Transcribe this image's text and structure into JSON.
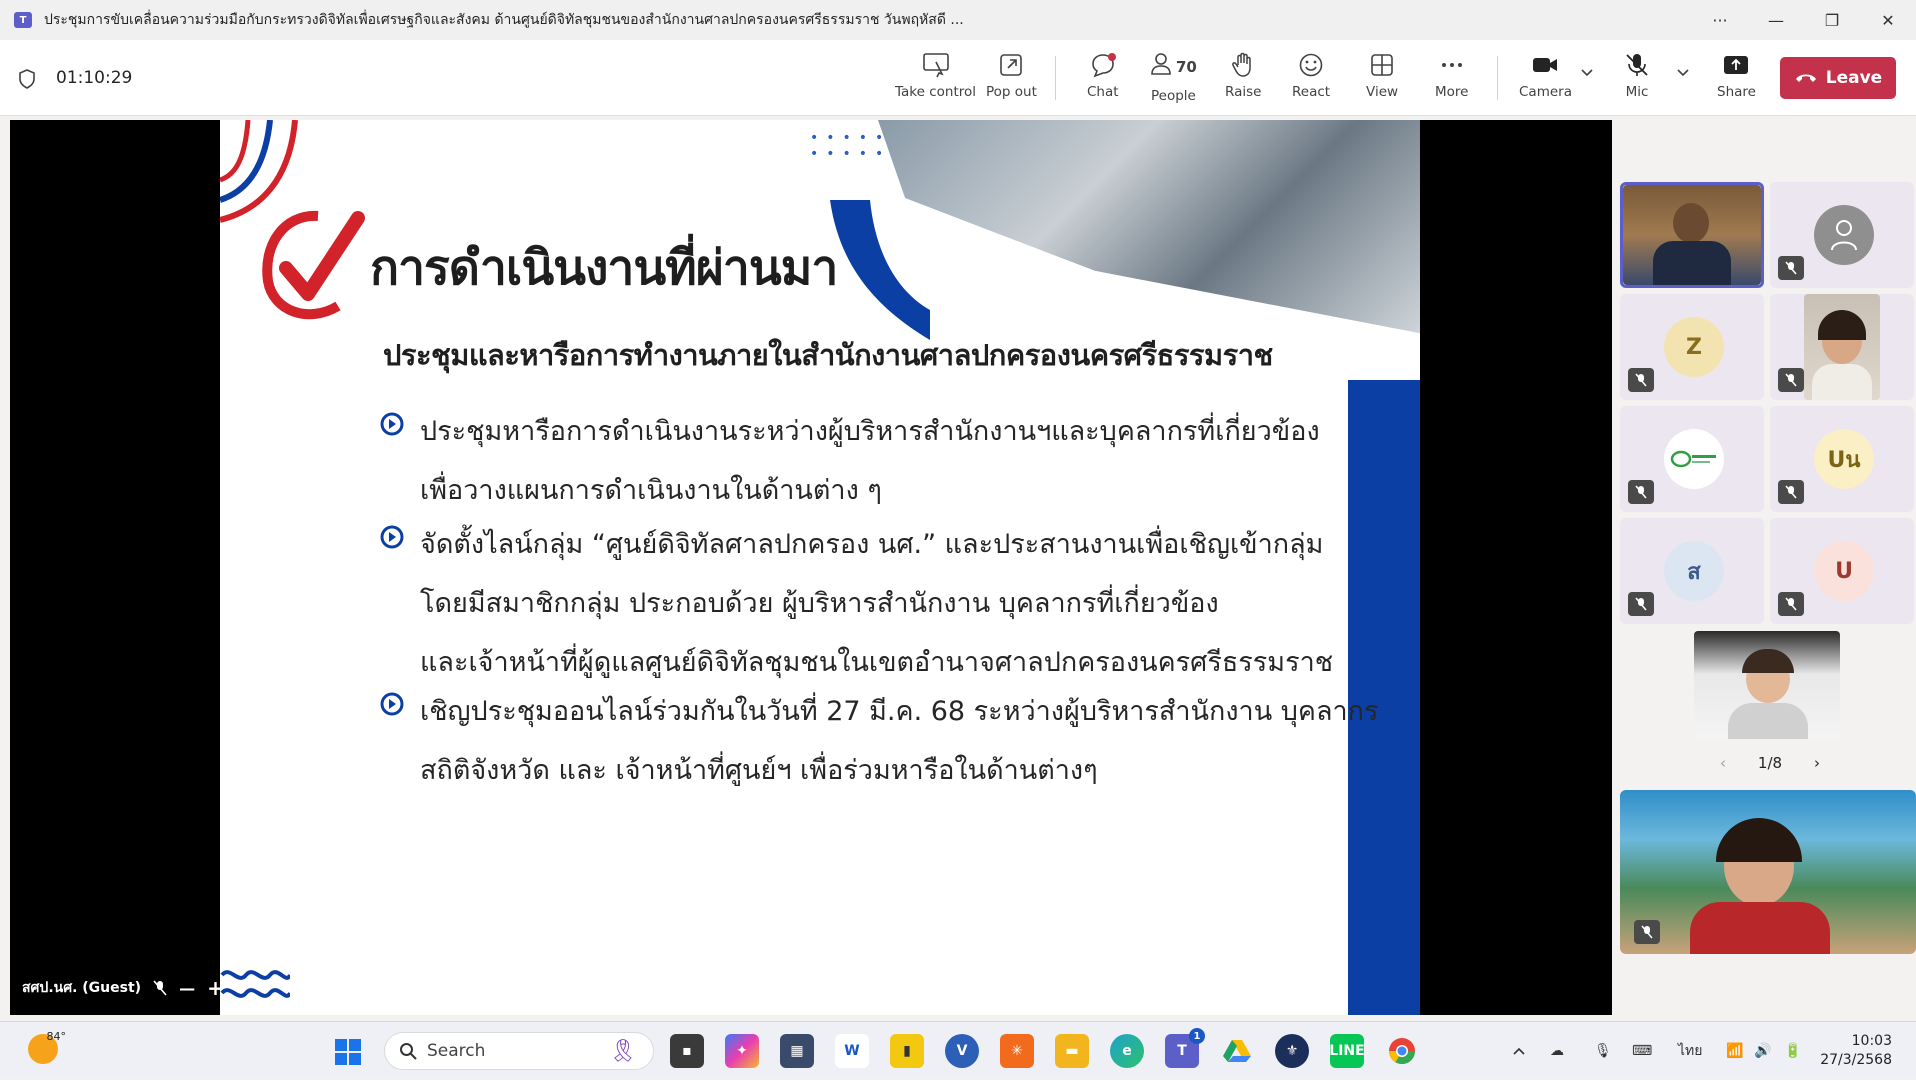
{
  "window": {
    "title": "ประชุมการขับเคลื่อนความร่วมมือกับกระทรวงดิจิทัลเพื่อเศรษฐกิจและสังคม ด้านศูนย์ดิจิทัลชุมชนของสำนักงานศาลปกครองนครศรีธรรมราช วันพฤหัสดี ...",
    "controls": {
      "more": "···",
      "minimize": "—",
      "restore": "❐",
      "close": "✕"
    }
  },
  "toolbar": {
    "timer": "01:10:29",
    "take_control": "Take control",
    "pop_out": "Pop out",
    "chat": "Chat",
    "people": "People",
    "people_count": "70",
    "raise": "Raise",
    "react": "React",
    "view": "View",
    "more": "More",
    "camera": "Camera",
    "mic": "Mic",
    "share": "Share",
    "leave": "Leave",
    "accent_color": "#c4314b"
  },
  "slide": {
    "title": "การดำเนินงานที่ผ่านมา",
    "subtitle": "ประชุมและหารือการทำงานภายในสำนักงานศาลปกครองนครศรีธรรมราช",
    "bullets": [
      {
        "lines": [
          "ประชุมหารือการดำเนินงานระหว่างผู้บริหารสำนักงานฯและบุคลากรที่เกี่ยวข้อง",
          "เพื่อวางแผนการดำเนินงานในด้านต่าง ๆ"
        ]
      },
      {
        "lines": [
          "จัดตั้งไลน์กลุ่ม “ศูนย์ดิจิทัลศาลปกครอง นศ.” และประสานงานเพื่อเชิญเข้ากลุ่ม",
          "โดยมีสมาชิกกลุ่ม ประกอบด้วย ผู้บริหารสำนักงาน บุคลากรที่เกี่ยวข้อง",
          "และเจ้าหน้าที่ผู้ดูแลศูนย์ดิจิทัลชุมชนในเขตอำนาจศาลปกครองนครศรีธรรมราช"
        ]
      },
      {
        "lines": [
          "เชิญประชุมออนไลน์ร่วมกันในวันที่ 27 มี.ค. 68 ระหว่างผู้บริหารสำนักงาน บุคลากร",
          "สถิติจังหวัด และ เจ้าหน้าที่ศูนย์ฯ เพื่อร่วมหารือในด้านต่างๆ"
        ]
      }
    ],
    "brand_blue": "#0b3fa3",
    "brand_red": "#d2232a"
  },
  "stage": {
    "presenter_label": "สศป.นศ. (Guest)"
  },
  "roster": {
    "tiles": [
      {
        "initials": "",
        "kind": "video"
      },
      {
        "initials": "",
        "kind": "default-avatar"
      },
      {
        "initials": "Z",
        "color": "#f3e3b0",
        "text_color": "#8a6d1f"
      },
      {
        "initials": "",
        "kind": "video"
      },
      {
        "initials": "",
        "kind": "logo"
      },
      {
        "initials": "Uน",
        "color": "#fbefc6",
        "text_color": "#7b6416"
      },
      {
        "initials": "ส",
        "color": "#dce6f2",
        "text_color": "#3a5a8c"
      },
      {
        "initials": "U",
        "color": "#fbe1dc",
        "text_color": "#9b3b30"
      }
    ],
    "pager": "1/8"
  },
  "taskbar": {
    "weather": "84°",
    "search_placeholder": "Search",
    "teams_badge": "1",
    "language": "ไทย",
    "time": "10:03",
    "date": "27/3/2568"
  }
}
